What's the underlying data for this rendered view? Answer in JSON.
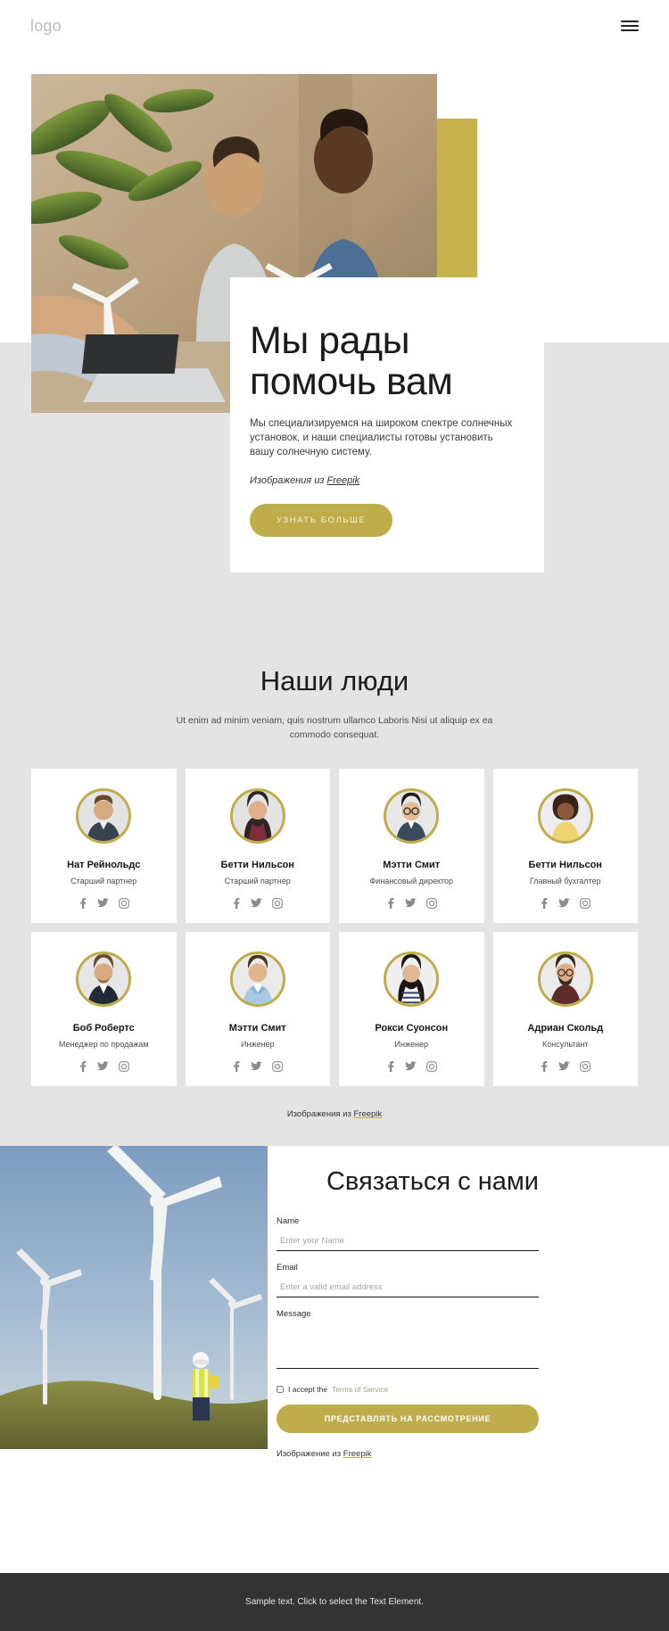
{
  "header": {
    "logo": "logo",
    "menu_icon": "hamburger-menu-icon"
  },
  "hero": {
    "title_line1": "Мы рады",
    "title_line2": "помочь вам",
    "description": "Мы специализируемся на широком спектре солнечных установок, и наши специалисты готовы установить вашу солнечную систему.",
    "credit_prefix": "Изображения из ",
    "credit_link": "Freepik",
    "cta_label": "УЗНАТЬ БОЛЬШЕ",
    "accent_color": "#bfac4b"
  },
  "team": {
    "heading": "Наши люди",
    "subtitle": "Ut enim ad minim veniam, quis nostrum ullamco Laboris Nisi ut aliquip ex ea commodo consequat.",
    "credit_prefix": "Изображения из ",
    "credit_link": "Freepik",
    "members": [
      {
        "name": "Нат Рейнольдс",
        "role": "Старший партнер"
      },
      {
        "name": "Бетти Нильсон",
        "role": "Старший партнер"
      },
      {
        "name": "Мэтти Смит",
        "role": "Финансовый директор"
      },
      {
        "name": "Бетти Нильсон",
        "role": "Главный бухгалтер"
      },
      {
        "name": "Боб Робертс",
        "role": "Менеджер по продажам"
      },
      {
        "name": "Мэтти Смит",
        "role": "Инженер"
      },
      {
        "name": "Рокси Суонсон",
        "role": "Инженер"
      },
      {
        "name": "Адриан Скольд",
        "role": "Консультант"
      }
    ],
    "social_icons": [
      "facebook-icon",
      "twitter-icon",
      "instagram-icon"
    ]
  },
  "contact": {
    "heading": "Связаться с нами",
    "name_label": "Name",
    "name_placeholder": "Enter your Name",
    "name_value": "",
    "email_label": "Email",
    "email_placeholder": "Enter a valid email address",
    "email_value": "",
    "message_label": "Message",
    "message_placeholder": "",
    "message_value": "",
    "accept_text": "I accept the ",
    "terms_link": "Terms of Service",
    "submit_label": "ПРЕДСТАВЛЯТЬ НА РАССМОТРЕНИЕ",
    "credit_prefix": "Изображение из ",
    "credit_link": "Freepik"
  },
  "footer": {
    "text": "Sample text. Click to select the Text Element."
  }
}
